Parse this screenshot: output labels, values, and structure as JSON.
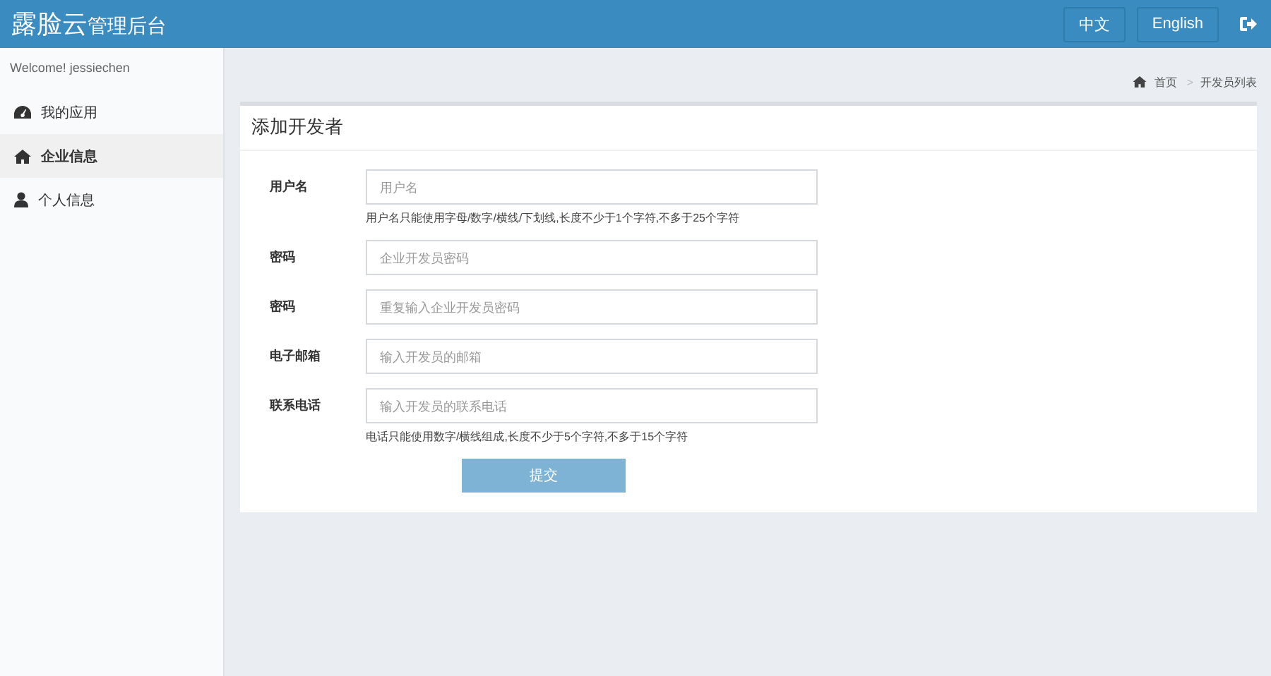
{
  "header": {
    "brand": "露脸云",
    "brand_suffix": "管理后台",
    "languages": [
      "中文",
      "English"
    ]
  },
  "sidebar": {
    "welcome": "Welcome! jessiechen",
    "items": [
      {
        "label": "我的应用",
        "kind": "dashboard",
        "selected": false
      },
      {
        "label": "企业信息",
        "kind": "home",
        "selected": true
      },
      {
        "label": "个人信息",
        "kind": "user",
        "selected": false
      }
    ]
  },
  "breadcrumb": [
    "首页",
    "开发员列表"
  ],
  "breadcrumb_separator": ">",
  "form": {
    "title": "添加开发者",
    "fields": [
      {
        "label": "用户名",
        "placeholder": "用户名",
        "hint": "用户名只能使用字母/数字/横线/下划线,长度不少于1个字符,不多于25个字符"
      },
      {
        "label": "密码",
        "placeholder": "企业开发员密码"
      },
      {
        "label": "密码",
        "placeholder": "重复输入企业开发员密码"
      },
      {
        "label": "电子邮箱",
        "placeholder": "输入开发员的邮箱"
      },
      {
        "label": "联系电话",
        "placeholder": "输入开发员的联系电话",
        "hint": "电话只能使用数字/横线组成,长度不少于5个字符,不多于15个字符"
      }
    ],
    "submit": "提交"
  }
}
